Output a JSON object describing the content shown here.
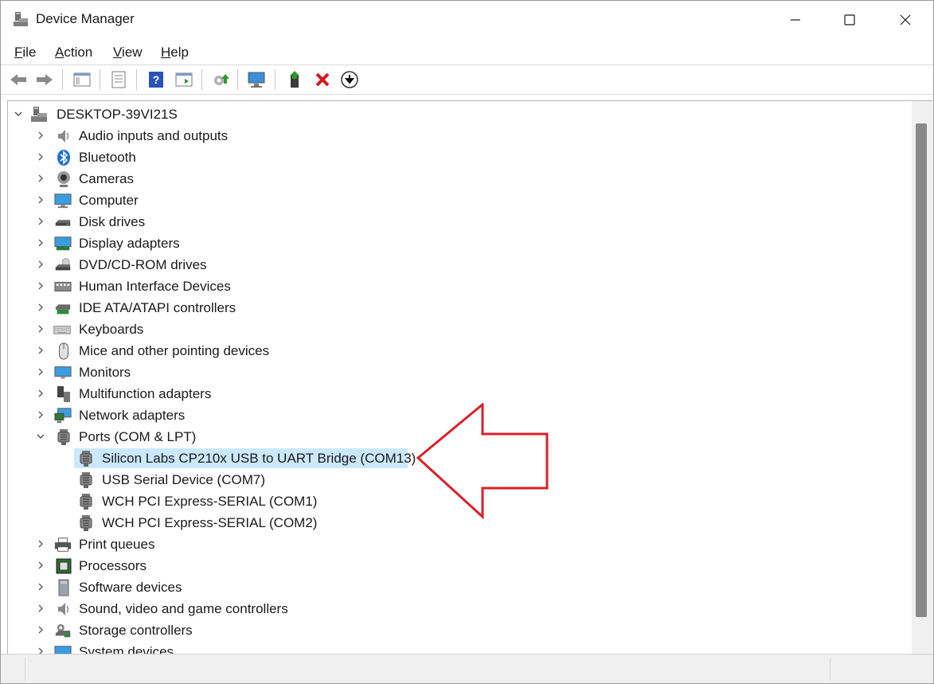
{
  "window": {
    "title": "Device Manager"
  },
  "menu": [
    "File",
    "Action",
    "View",
    "Help"
  ],
  "tree": {
    "root": "DESKTOP-39VI21S",
    "categories": [
      "Audio inputs and outputs",
      "Bluetooth",
      "Cameras",
      "Computer",
      "Disk drives",
      "Display adapters",
      "DVD/CD-ROM drives",
      "Human Interface Devices",
      "IDE ATA/ATAPI controllers",
      "Keyboards",
      "Mice and other pointing devices",
      "Monitors",
      "Multifunction adapters",
      "Network adapters",
      "Ports (COM & LPT)",
      "Print queues",
      "Processors",
      "Software devices",
      "Sound, video and game controllers",
      "Storage controllers",
      "System devices"
    ],
    "ports_children": [
      "Silicon Labs CP210x USB to UART Bridge (COM13)",
      "USB Serial Device (COM7)",
      "WCH PCI Express-SERIAL (COM1)",
      "WCH PCI Express-SERIAL (COM2)"
    ]
  },
  "colors": {
    "selection": "#cce8ff",
    "annotation_arrow": "#d9202a"
  }
}
